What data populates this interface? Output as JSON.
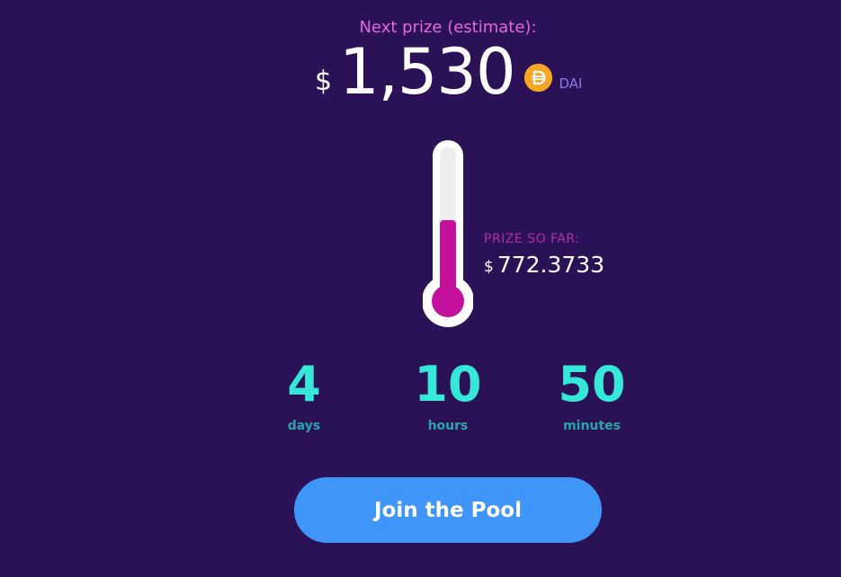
{
  "prize": {
    "label": "Next prize (estimate):",
    "currency_symbol": "$",
    "amount": "1,530",
    "token_icon": "dai-icon",
    "token": "DAI"
  },
  "prize_so_far": {
    "label": "PRIZE SO FAR:",
    "currency_symbol": "$",
    "value": "772.3733",
    "fill_fraction": 0.5
  },
  "countdown": [
    {
      "value": "4",
      "unit": "days"
    },
    {
      "value": "10",
      "unit": "hours"
    },
    {
      "value": "50",
      "unit": "minutes"
    }
  ],
  "cta": {
    "label": "Join the Pool"
  },
  "colors": {
    "background": "#2b1257",
    "accent_pink": "#e466e0",
    "thermo_fill": "#c3119e",
    "countdown": "#35e8d8",
    "button": "#4095f8",
    "dai": "#f5a623"
  }
}
